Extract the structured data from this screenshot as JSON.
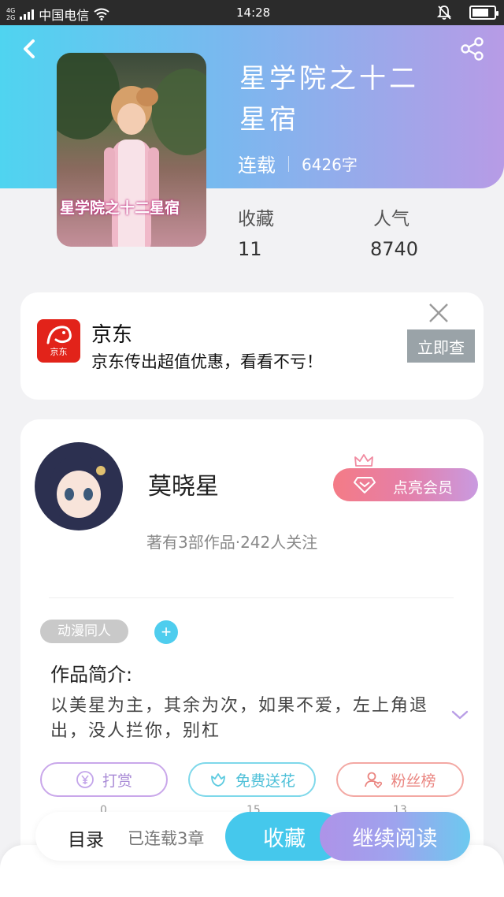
{
  "status_bar": {
    "network": [
      "4G",
      "2G"
    ],
    "carrier": "中国电信",
    "time": "14:28",
    "battery_level": 0.75
  },
  "book": {
    "cover_title": "星学院之十二星宿",
    "title": "星学院之十二星宿",
    "status": "连载",
    "word_count": "6426字",
    "stats": {
      "favorites_label": "收藏",
      "favorites_value": "11",
      "popularity_label": "人气",
      "popularity_value": "8740"
    }
  },
  "ad": {
    "logo_text": "京东",
    "name": "京东",
    "description": "京东传出超值优惠，看看不亏！",
    "cta": "立即查"
  },
  "author": {
    "name": "莫晓星",
    "stats": "著有3部作品·242人关注",
    "vip_button": "点亮会员"
  },
  "work": {
    "tag": "动漫同人",
    "tag_add": "+",
    "intro_title": "作品简介:",
    "intro_text": "以美星为主，其余为次，如果不爱，左上角退出，没人拦你，别杠"
  },
  "actions": {
    "reward": "打赏",
    "flower": "免费送花",
    "fans": "粉丝榜"
  },
  "action_counts": {
    "reward": "0",
    "flower": "15",
    "fans": "13"
  },
  "bottom": {
    "toc": "目录",
    "chapters": "已连载3章",
    "favorite": "收藏",
    "continue": "继续阅读"
  },
  "colors": {
    "header_start": "#4fd4f0",
    "header_end": "#b79be6",
    "accent_blue": "#45c8ec",
    "accent_purple": "#ae93e8",
    "jd_red": "#e2231a"
  }
}
